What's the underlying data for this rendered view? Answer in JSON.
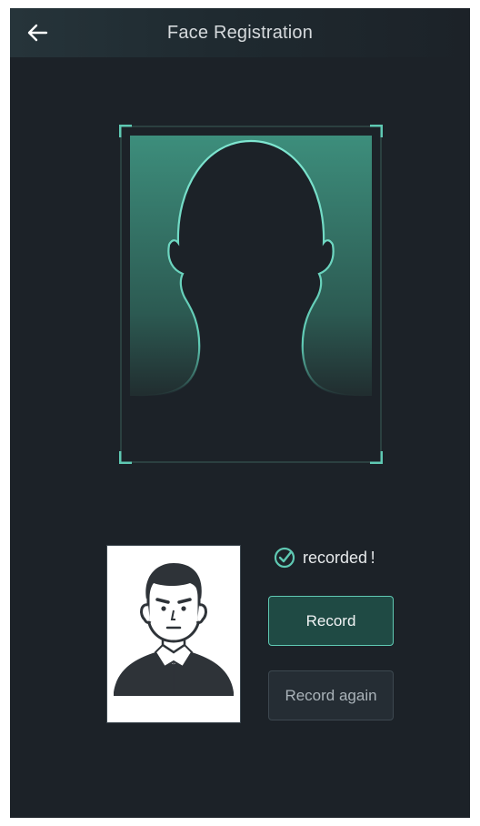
{
  "header": {
    "title": "Face Registration",
    "back_icon": "arrow-left-icon"
  },
  "capture_frame": {
    "icon": "face-silhouette-icon",
    "accent_color": "#5fc9b3"
  },
  "result": {
    "status_icon": "check-circle-icon",
    "status_text": "recorded !",
    "record_label": "Record",
    "record_again_label": "Record again"
  },
  "colors": {
    "background": "#1c2228",
    "accent": "#5fc9b3",
    "primary_button_bg": "#1f4a44"
  }
}
